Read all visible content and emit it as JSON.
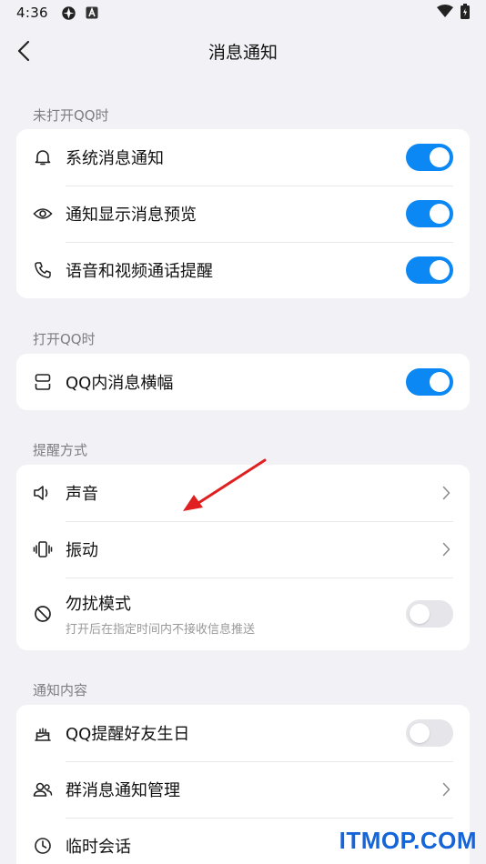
{
  "status_bar": {
    "time": "4:36",
    "icons": [
      "photo-app-icon",
      "a-notification-icon"
    ],
    "right_icons": [
      "wifi-icon",
      "battery-icon"
    ]
  },
  "header": {
    "title": "消息通知",
    "back_icon": "chevron-left-icon"
  },
  "sections": {
    "closed": {
      "label": "未打开QQ时",
      "items": [
        {
          "label": "系统消息通知",
          "icon": "bell-icon",
          "toggle": true
        },
        {
          "label": "通知显示消息预览",
          "icon": "eye-icon",
          "toggle": true
        },
        {
          "label": "语音和视频通话提醒",
          "icon": "phone-icon",
          "toggle": true
        }
      ]
    },
    "open": {
      "label": "打开QQ时",
      "items": [
        {
          "label": "QQ内消息横幅",
          "icon": "banner-icon",
          "toggle": true
        }
      ]
    },
    "reminder": {
      "label": "提醒方式",
      "items": [
        {
          "label": "声音",
          "icon": "speaker-icon"
        },
        {
          "label": "振动",
          "icon": "vibrate-icon"
        },
        {
          "label": "勿扰模式",
          "sub": "打开后在指定时间内不接收信息推送",
          "icon": "do-not-disturb-icon",
          "toggle": false
        }
      ]
    },
    "content": {
      "label": "通知内容",
      "items": [
        {
          "label": "QQ提醒好友生日",
          "icon": "cake-icon",
          "toggle": false
        },
        {
          "label": "群消息通知管理",
          "icon": "group-icon"
        },
        {
          "label": "临时会话",
          "icon": "clock-icon"
        }
      ]
    }
  },
  "colors": {
    "accent": "#0b88f4",
    "background": "#f2f2f6",
    "card": "#ffffff",
    "annotation_arrow": "#e02020",
    "watermark": "#1565d8"
  },
  "watermark": "ITMOP.COM"
}
